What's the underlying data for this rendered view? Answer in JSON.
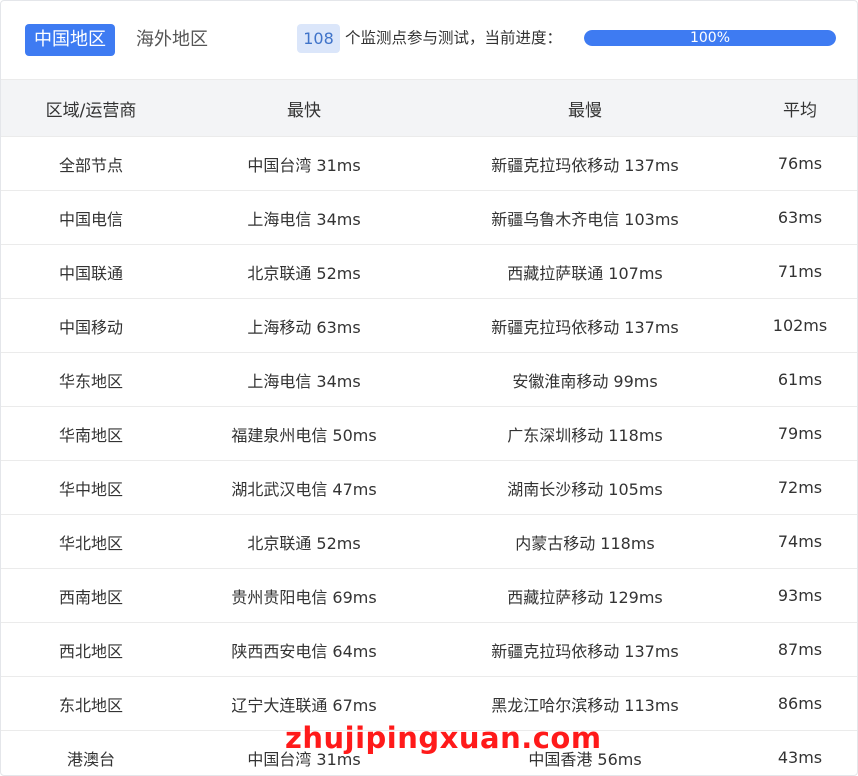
{
  "tabs": {
    "domestic": "中国地区",
    "overseas": "海外地区"
  },
  "progress": {
    "node_count": "108",
    "label": "个监测点参与测试，当前进度：",
    "percent_text": "100%",
    "percent": 100
  },
  "table": {
    "headers": [
      "区域/运营商",
      "最快",
      "最慢",
      "平均"
    ],
    "rows": [
      [
        "全部节点",
        "中国台湾 31ms",
        "新疆克拉玛依移动 137ms",
        "76ms"
      ],
      [
        "中国电信",
        "上海电信 34ms",
        "新疆乌鲁木齐电信 103ms",
        "63ms"
      ],
      [
        "中国联通",
        "北京联通 52ms",
        "西藏拉萨联通 107ms",
        "71ms"
      ],
      [
        "中国移动",
        "上海移动 63ms",
        "新疆克拉玛依移动 137ms",
        "102ms"
      ],
      [
        "华东地区",
        "上海电信 34ms",
        "安徽淮南移动 99ms",
        "61ms"
      ],
      [
        "华南地区",
        "福建泉州电信 50ms",
        "广东深圳移动 118ms",
        "79ms"
      ],
      [
        "华中地区",
        "湖北武汉电信 47ms",
        "湖南长沙移动 105ms",
        "72ms"
      ],
      [
        "华北地区",
        "北京联通 52ms",
        "内蒙古移动 118ms",
        "74ms"
      ],
      [
        "西南地区",
        "贵州贵阳电信 69ms",
        "西藏拉萨移动 129ms",
        "93ms"
      ],
      [
        "西北地区",
        "陕西西安电信 64ms",
        "新疆克拉玛依移动 137ms",
        "87ms"
      ],
      [
        "东北地区",
        "辽宁大连联通 67ms",
        "黑龙江哈尔滨移动 113ms",
        "86ms"
      ],
      [
        "港澳台",
        "中国台湾 31ms",
        "中国香港 56ms",
        "43ms"
      ]
    ]
  },
  "watermark": "zhujipingxuan.com",
  "colors": {
    "accent": "#3e7bf2",
    "badge_bg": "#dbe6fa",
    "header_bg": "#f3f4f6",
    "watermark": "#ff1a1a"
  }
}
